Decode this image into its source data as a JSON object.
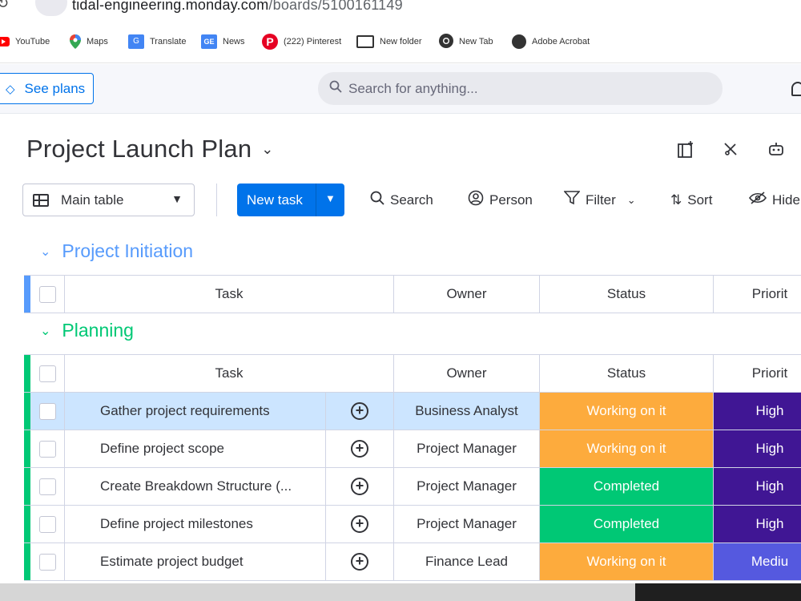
{
  "browser": {
    "url_host": "tidal-engineering.monday.com",
    "url_path": "/boards/5100161149",
    "bookmarks": [
      {
        "label": "YouTube",
        "icon": "youtube-icon"
      },
      {
        "label": "Maps",
        "icon": "maps-icon"
      },
      {
        "label": "Translate",
        "icon": "translate-icon"
      },
      {
        "label": "News",
        "icon": "news-icon"
      },
      {
        "label": "(222) Pinterest",
        "icon": "pinterest-icon"
      },
      {
        "label": "New folder",
        "icon": "folder-icon"
      },
      {
        "label": "New Tab",
        "icon": "chrome-icon"
      },
      {
        "label": "Adobe Acrobat",
        "icon": "globe-icon"
      }
    ]
  },
  "header": {
    "see_plans": "See plans",
    "search_placeholder": "Search for anything..."
  },
  "board": {
    "title": "Project Launch Plan"
  },
  "toolbar": {
    "view": "Main table",
    "new_task": "New task",
    "search": "Search",
    "person": "Person",
    "filter": "Filter",
    "sort": "Sort",
    "hide": "Hide"
  },
  "groups": [
    {
      "title": "Project Initiation",
      "color": "#579bfc",
      "columns": {
        "task": "Task",
        "owner": "Owner",
        "status": "Status",
        "priority": "Priorit"
      }
    },
    {
      "title": "Planning",
      "color": "#00c875",
      "columns": {
        "task": "Task",
        "owner": "Owner",
        "status": "Status",
        "priority": "Priorit"
      },
      "rows": [
        {
          "task": "Gather project requirements",
          "owner": "Business Analyst",
          "status": "Working on it",
          "status_color": "#fdab3d",
          "priority": "High",
          "priority_color": "#401694"
        },
        {
          "task": "Define project scope",
          "owner": "Project Manager",
          "status": "Working on it",
          "status_color": "#fdab3d",
          "priority": "High",
          "priority_color": "#401694"
        },
        {
          "task": "Create Breakdown Structure (...",
          "owner": "Project Manager",
          "status": "Completed",
          "status_color": "#00c875",
          "priority": "High",
          "priority_color": "#401694"
        },
        {
          "task": "Define project milestones",
          "owner": "Project Manager",
          "status": "Completed",
          "status_color": "#00c875",
          "priority": "High",
          "priority_color": "#401694"
        },
        {
          "task": "Estimate project budget",
          "owner": "Finance Lead",
          "status": "Working on it",
          "status_color": "#fdab3d",
          "priority": "Mediu",
          "priority_color": "#5559df"
        }
      ]
    }
  ]
}
